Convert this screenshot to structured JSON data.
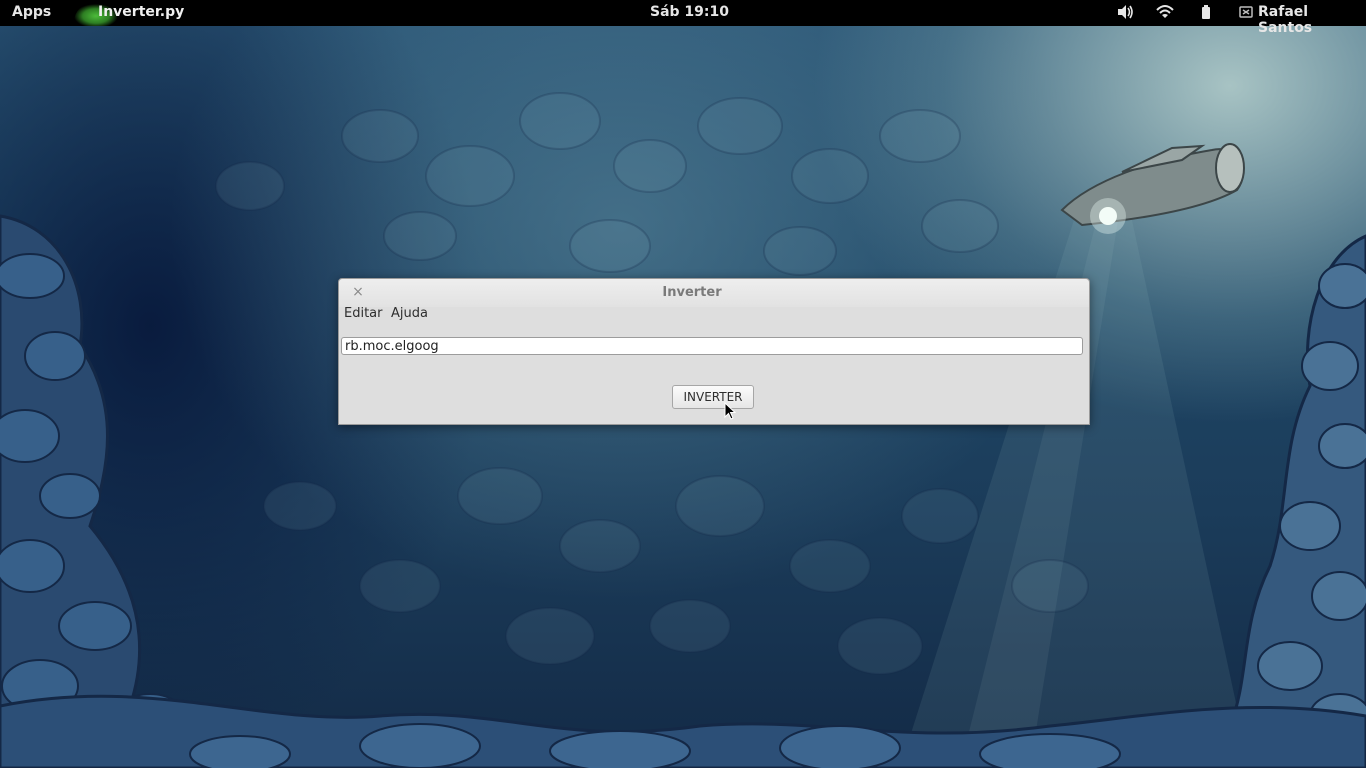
{
  "topbar": {
    "apps_label": "Apps",
    "app_name": "Inverter.py",
    "clock": "Sáb 19:10",
    "user_name": "Rafael Santos",
    "icons": [
      "volume-icon",
      "wifi-icon",
      "battery-icon",
      "user-status-icon"
    ]
  },
  "window": {
    "title": "Inverter",
    "close_glyph": "×",
    "menu": [
      "Editar",
      "Ajuda"
    ],
    "entry_value": "rb.moc.elgoog",
    "button_label": "INVERTER"
  },
  "colors": {
    "topbar_bg": "#000000",
    "window_bg": "#dedede",
    "wallpaper_deep": "#132a46"
  }
}
